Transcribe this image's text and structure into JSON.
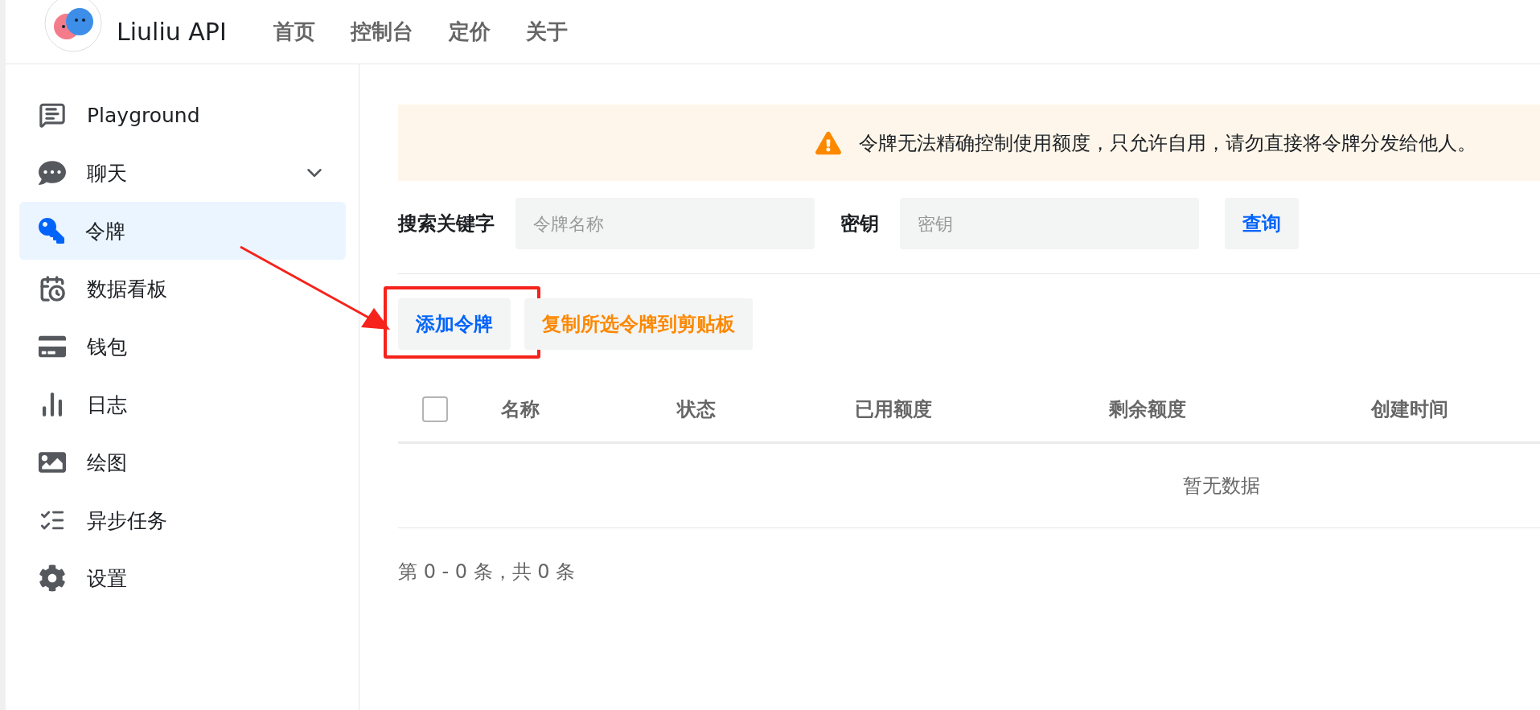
{
  "header": {
    "brand": "Liuliu API",
    "nav": [
      {
        "label": "首页"
      },
      {
        "label": "控制台"
      },
      {
        "label": "定价"
      },
      {
        "label": "关于"
      }
    ]
  },
  "sidebar": {
    "items": [
      {
        "label": "Playground",
        "kind": "link",
        "selected": false
      },
      {
        "label": "聊天",
        "kind": "group",
        "selected": false
      },
      {
        "label": "令牌",
        "kind": "link",
        "selected": true
      },
      {
        "label": "数据看板",
        "kind": "link",
        "selected": false
      },
      {
        "label": "钱包",
        "kind": "link",
        "selected": false
      },
      {
        "label": "日志",
        "kind": "link",
        "selected": false
      },
      {
        "label": "绘图",
        "kind": "link",
        "selected": false
      },
      {
        "label": "异步任务",
        "kind": "link",
        "selected": false
      },
      {
        "label": "设置",
        "kind": "link",
        "selected": false
      }
    ]
  },
  "notice": {
    "text": "令牌无法精确控制使用额度，只允许自用，请勿直接将令牌分发给他人。"
  },
  "search": {
    "fields": [
      {
        "label": "搜索关键字",
        "placeholder": "令牌名称"
      },
      {
        "label": "密钥",
        "placeholder": "密钥"
      }
    ],
    "button": "查询"
  },
  "actions": [
    {
      "label": "添加令牌",
      "kind": "primary",
      "annotated": true
    },
    {
      "label": "复制所选令牌到剪贴板",
      "kind": "warning",
      "annotated": false
    }
  ],
  "table": {
    "select_all": {
      "checked": false
    },
    "columns": [
      "名称",
      "状态",
      "已用额度",
      "剩余额度",
      "创建时间"
    ],
    "empty_text": "暂无数据"
  },
  "pagination": "第 0 - 0 条，共 0 条"
}
